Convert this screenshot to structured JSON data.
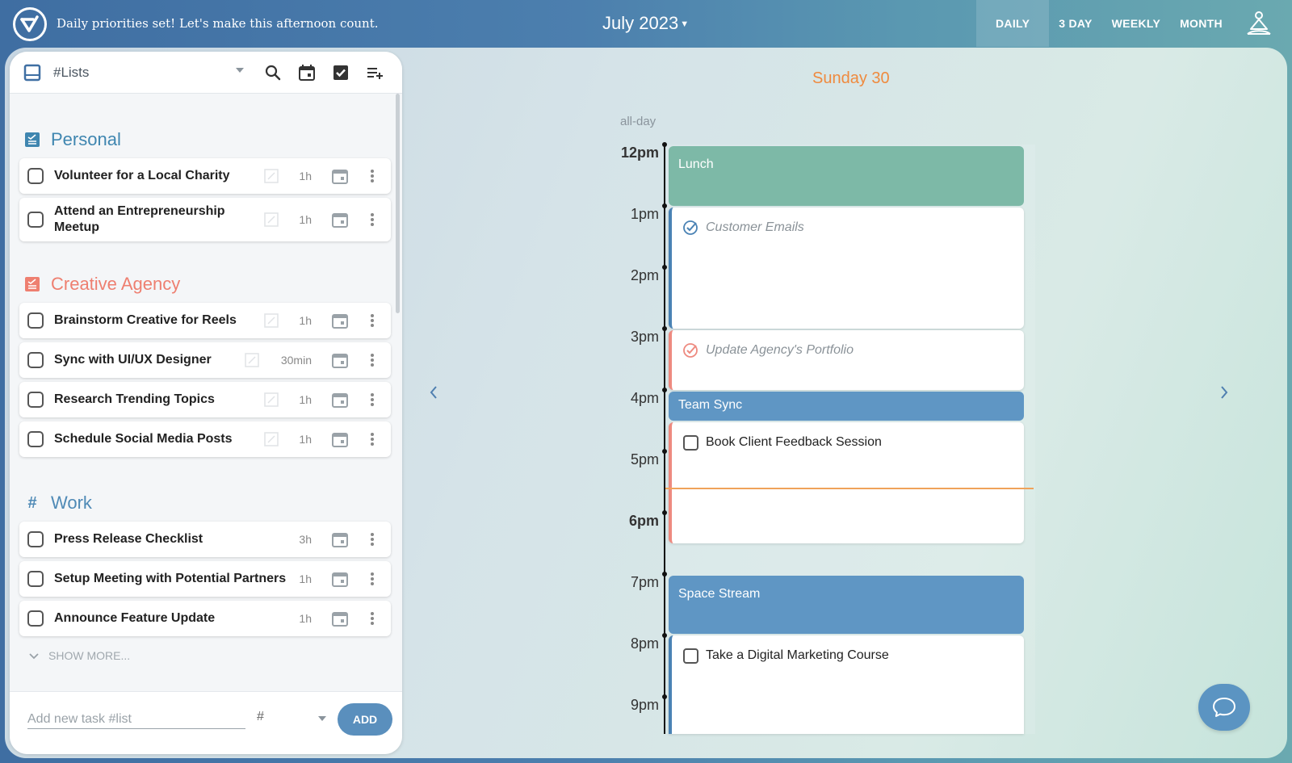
{
  "header": {
    "banner": "Daily priorities set! Let's make this afternoon count.",
    "month": "July 2023",
    "views": [
      "DAILY",
      "3 DAY",
      "WEEKLY",
      "MONTH"
    ],
    "active_view": "DAILY"
  },
  "lists": {
    "title": "#Lists",
    "sections": [
      {
        "name": "Personal",
        "color": "#3f86b0",
        "icon": "checklist-icon",
        "tasks": [
          {
            "name": "Volunteer for a Local Charity",
            "duration": "1h"
          },
          {
            "name": "Attend an Entrepreneurship Meetup",
            "duration": "1h"
          }
        ]
      },
      {
        "name": "Creative Agency",
        "color": "#ee7f70",
        "icon": "checklist-icon",
        "tasks": [
          {
            "name": "Brainstorm Creative for Reels",
            "duration": "1h"
          },
          {
            "name": "Sync with UI/UX Designer",
            "duration": "30min"
          },
          {
            "name": "Research Trending Topics",
            "duration": "1h"
          },
          {
            "name": "Schedule Social Media Posts",
            "duration": "1h"
          }
        ]
      },
      {
        "name": "Work",
        "color": "#4f8ab6",
        "icon": "hash-icon",
        "tasks": [
          {
            "name": "Press Release Checklist",
            "duration": "3h"
          },
          {
            "name": "Setup Meeting with Potential Partners",
            "duration": "1h"
          },
          {
            "name": "Announce Feature Update",
            "duration": "1h"
          }
        ]
      }
    ],
    "show_more": "SHOW MORE...",
    "add_placeholder": "Add new task #list",
    "list_select": "#",
    "add_label": "ADD"
  },
  "calendar": {
    "day": "Sunday 30",
    "allday_label": "all-day",
    "hours": [
      "12pm",
      "1pm",
      "2pm",
      "3pm",
      "4pm",
      "5pm",
      "6pm",
      "7pm",
      "8pm",
      "9pm"
    ],
    "events": [
      {
        "title": "Lunch",
        "kind": "solid",
        "color": "#7db9a7"
      },
      {
        "title": "Customer Emails",
        "kind": "done",
        "color": "#4a82b4"
      },
      {
        "title": "Update Agency's Portfolio",
        "kind": "done",
        "color": "#ee8a80"
      },
      {
        "title": "Team Sync",
        "kind": "solid",
        "color": "#5f96c4"
      },
      {
        "title": "Book Client Feedback Session",
        "kind": "task",
        "color": "#ee8a80"
      },
      {
        "title": "Space Stream",
        "kind": "solid",
        "color": "#5f96c4"
      },
      {
        "title": "Take a Digital Marketing Course",
        "kind": "task",
        "color": "#4a82b4"
      }
    ]
  },
  "colors": {
    "accent": "#5a8fbd",
    "today": "#ef8a3e",
    "now_line": "#f0a35a"
  }
}
